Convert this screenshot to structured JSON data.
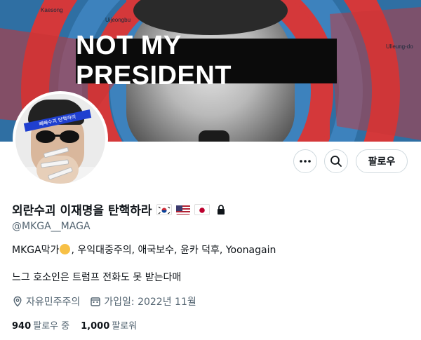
{
  "banner": {
    "headline": "NOT MY PRESIDENT",
    "map_labels": [
      "Kaesong",
      "Uijeongbu",
      "Ulleung-do"
    ]
  },
  "actions": {
    "more_icon": "more-horizontal-icon",
    "search_icon": "search-icon",
    "follow_label": "팔로우"
  },
  "avatar": {
    "band_text": "빼빼수괴 탄핵하라"
  },
  "profile": {
    "display_name": "외란수괴 이재명을 탄핵하라",
    "badges": [
      "korea-flag",
      "usa-flag",
      "japan-flag",
      "lock-icon"
    ],
    "handle": "@MKGA__MAGA",
    "bio_line1_before": "MKGA막가",
    "bio_line1_after": ", 우익대중주의, 애국보수, 윤카 덕후, Yoonagain",
    "bio_line2": "느그 호소인은 트럼프 전화도 못 받는다매",
    "location": "자유민주주의",
    "joined": "가입일: 2022년 11월",
    "following_count": "940",
    "following_label": "팔로우 중",
    "followers_count": "1,000",
    "followers_label": "팔로워"
  },
  "colors": {
    "banner_red": "#d4383a",
    "map_blue": "#2f6fa3",
    "text_primary": "#0f1419",
    "text_secondary": "#536471",
    "border": "#cfd9de"
  }
}
